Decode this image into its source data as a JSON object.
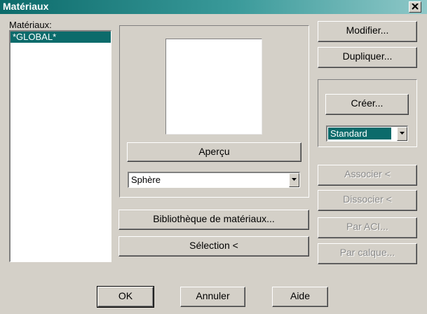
{
  "window": {
    "title": "Matériaux"
  },
  "materials": {
    "label": "Matériaux:",
    "items": [
      "*GLOBAL*"
    ]
  },
  "preview": {
    "button_label": "Aperçu",
    "shape_value": "Sphère"
  },
  "library_button": "Bibliothèque de matériaux...",
  "selection_button": "Sélection <",
  "right_panel": {
    "modify": "Modifier...",
    "duplicate": "Dupliquer...",
    "create": "Créer...",
    "type_value": "Standard",
    "attach": "Associer <",
    "detach": "Dissocier <",
    "by_aci": "Par ACI...",
    "by_layer": "Par calque..."
  },
  "footer": {
    "ok": "OK",
    "cancel": "Annuler",
    "help": "Aide"
  },
  "colors": {
    "title_bar": "#0c6b6b",
    "selection": "#0c6b6b",
    "face": "#d4d0c8"
  }
}
